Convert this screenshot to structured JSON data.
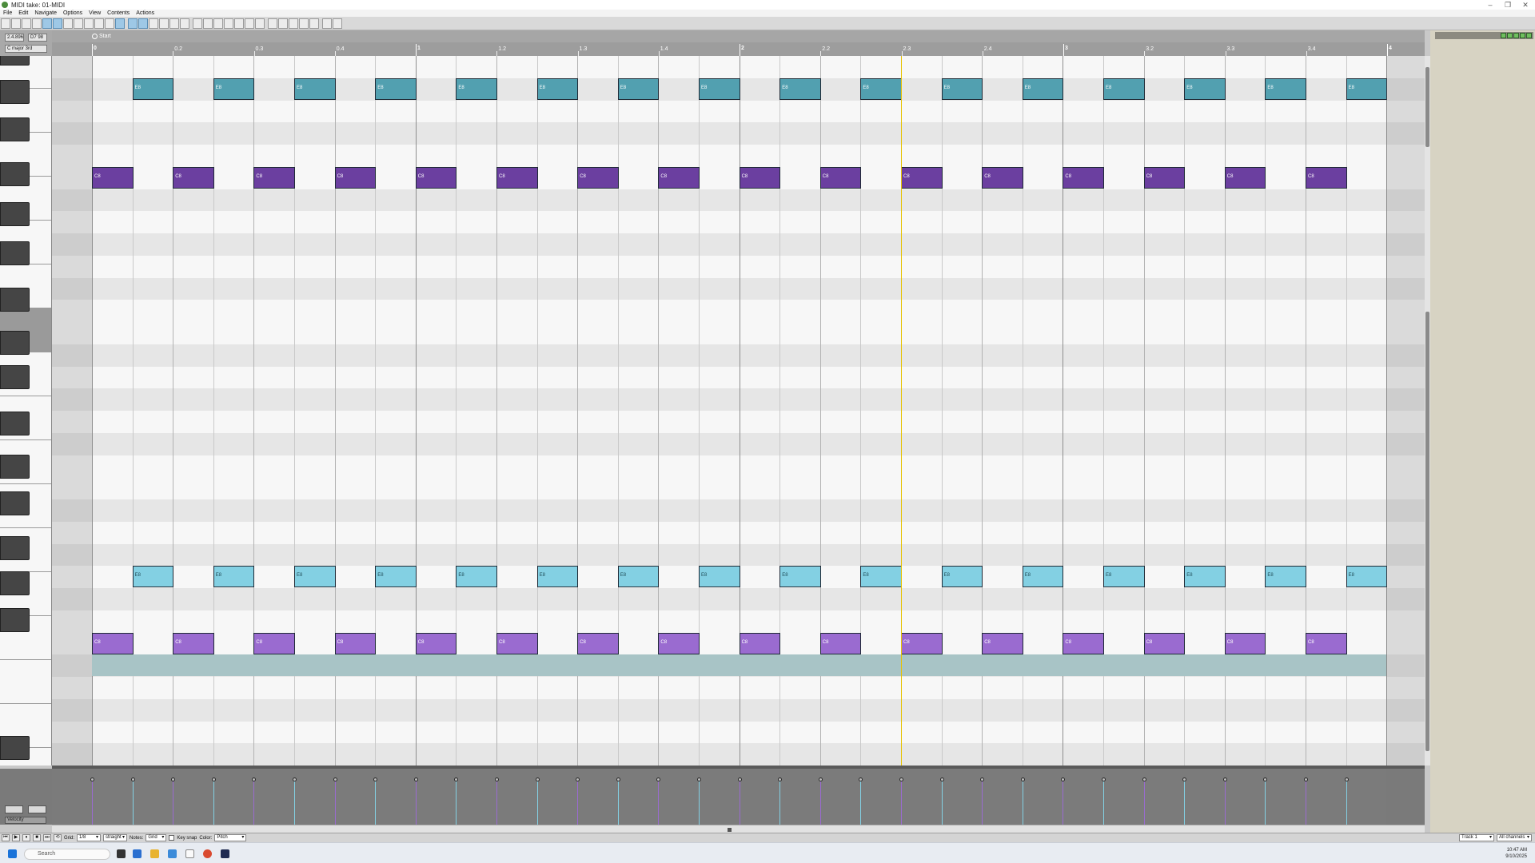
{
  "window": {
    "title": "MIDI take: 01-MIDI",
    "controls": [
      "–",
      "❐",
      "✕"
    ]
  },
  "menu": [
    "File",
    "Edit",
    "Navigate",
    "Options",
    "View",
    "Contents",
    "Actions"
  ],
  "left_info": {
    "position": "2.4.896",
    "note": "D7 98",
    "scale": "C major 3rd"
  },
  "ruler": {
    "start_label": "Start",
    "labels": [
      {
        "t": "0",
        "major": true
      },
      {
        "t": "0.2"
      },
      {
        "t": "0.3"
      },
      {
        "t": "0.4"
      },
      {
        "t": "1",
        "major": true
      },
      {
        "t": "1.2"
      },
      {
        "t": "1.3"
      },
      {
        "t": "1.4"
      },
      {
        "t": "2",
        "major": true
      },
      {
        "t": "2.2"
      },
      {
        "t": "2.3"
      },
      {
        "t": "2.4"
      },
      {
        "t": "3",
        "major": true
      },
      {
        "t": "3.2"
      },
      {
        "t": "3.3"
      },
      {
        "t": "3.4"
      },
      {
        "t": "4",
        "major": true
      }
    ]
  },
  "notes": {
    "label_teal": "E8",
    "label_purple": "C8",
    "label_cyan": "E8",
    "label_lilac": "C8"
  },
  "velocity": {
    "lane_label": "Velocity"
  },
  "status": {
    "grid_label": "Grid:",
    "grid_value": "1/8",
    "swing_value": "straight",
    "notes_label": "Notes:",
    "notes_value": "Grid",
    "keysnap_label": "Key snap",
    "color_label": "Color:",
    "color_value": "Pitch",
    "track_value": "Track 1",
    "channel_value": "All channels"
  },
  "taskbar": {
    "search_placeholder": "Search",
    "time": "10:47 AM",
    "date": "9/10/2025"
  },
  "colors": {
    "note_teal": "#52a0b0",
    "note_purple": "#6b3fa0",
    "note_cyan": "#83d0e3",
    "note_lilac": "#9a6bd0",
    "playhead": "#e6c200"
  }
}
